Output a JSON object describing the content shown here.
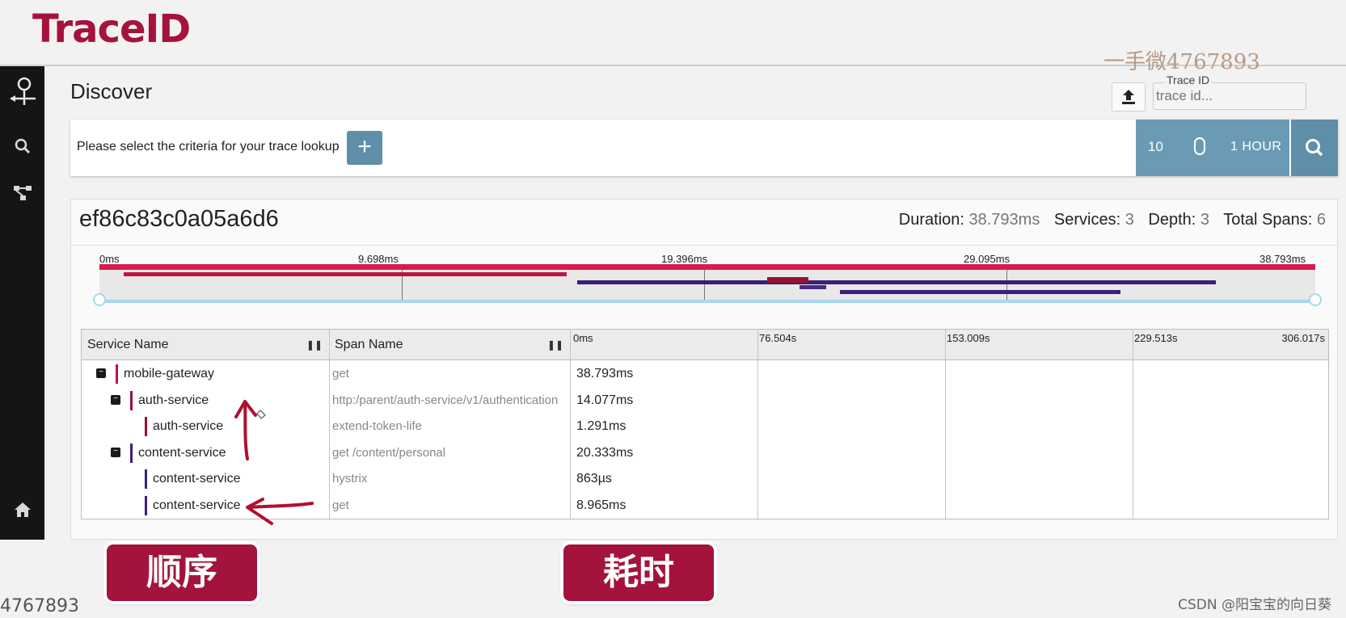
{
  "header": {
    "title": "TraceID",
    "watermark": "一手微4767893"
  },
  "sidebar": {
    "icons": [
      "zipkin-logo-icon",
      "search-icon",
      "dependencies-icon",
      "home-icon"
    ]
  },
  "discover": {
    "title": "Discover",
    "upload_icon": "upload-icon",
    "trace_id_label": "Trace ID",
    "trace_id_placeholder": "trace id..."
  },
  "criteria": {
    "prompt": "Please select the criteria for your trace lookup",
    "add_label": "+",
    "limit": "10",
    "lookback": "1 HOUR",
    "search_icon": "search-icon"
  },
  "trace": {
    "id": "ef86c83c0a05a6d6",
    "duration_label": "Duration:",
    "duration": "38.793ms",
    "services_label": "Services:",
    "services": "3",
    "depth_label": "Depth:",
    "depth": "3",
    "total_spans_label": "Total Spans:",
    "total_spans": "6",
    "minimap_ticks": [
      "0ms",
      "9.698ms",
      "19.396ms",
      "29.095ms",
      "38.793ms"
    ],
    "minimap_bars": [
      {
        "start": 0.0,
        "end": 1.0,
        "color": "#d81b4d"
      },
      {
        "start": 0.02,
        "end": 0.384,
        "color": "#c2123f"
      },
      {
        "start": 0.393,
        "end": 0.918,
        "color": "#3b1f78"
      },
      {
        "start": 0.549,
        "end": 0.583,
        "color": "#9b1030"
      },
      {
        "start": 0.576,
        "end": 0.598,
        "color": "#4a2a8c"
      },
      {
        "start": 0.609,
        "end": 0.84,
        "color": "#3b1f78"
      }
    ]
  },
  "table": {
    "col_service": "Service Name",
    "col_span": "Span Name",
    "timeline_ticks": [
      "0ms",
      "76.504s",
      "153.009s",
      "229.513s",
      "306.017s"
    ],
    "rows": [
      {
        "service": "mobile-gateway",
        "span": "get",
        "duration": "38.793ms",
        "depth": 0,
        "collapsible": true,
        "color": "#c2123f"
      },
      {
        "service": "auth-service",
        "span": "http:/parent/auth-service/v1/authentication",
        "duration": "14.077ms",
        "depth": 1,
        "collapsible": true,
        "color": "#9b1030"
      },
      {
        "service": "auth-service",
        "span": "extend-token-life",
        "duration": "1.291ms",
        "depth": 2,
        "collapsible": false,
        "color": "#9b1030"
      },
      {
        "service": "content-service",
        "span": "get /content/personal",
        "duration": "20.333ms",
        "depth": 1,
        "collapsible": true,
        "color": "#3b1f78"
      },
      {
        "service": "content-service",
        "span": "hystrix",
        "duration": "863µs",
        "depth": 2,
        "collapsible": false,
        "color": "#3b1f78"
      },
      {
        "service": "content-service",
        "span": "get",
        "duration": "8.965ms",
        "depth": 2,
        "collapsible": false,
        "color": "#3b1f78"
      }
    ]
  },
  "annotations": {
    "order_label": "顺序",
    "duration_label": "耗时"
  },
  "footer": {
    "watermark": "4767893",
    "credit": "CSDN @阳宝宝的向日葵"
  }
}
